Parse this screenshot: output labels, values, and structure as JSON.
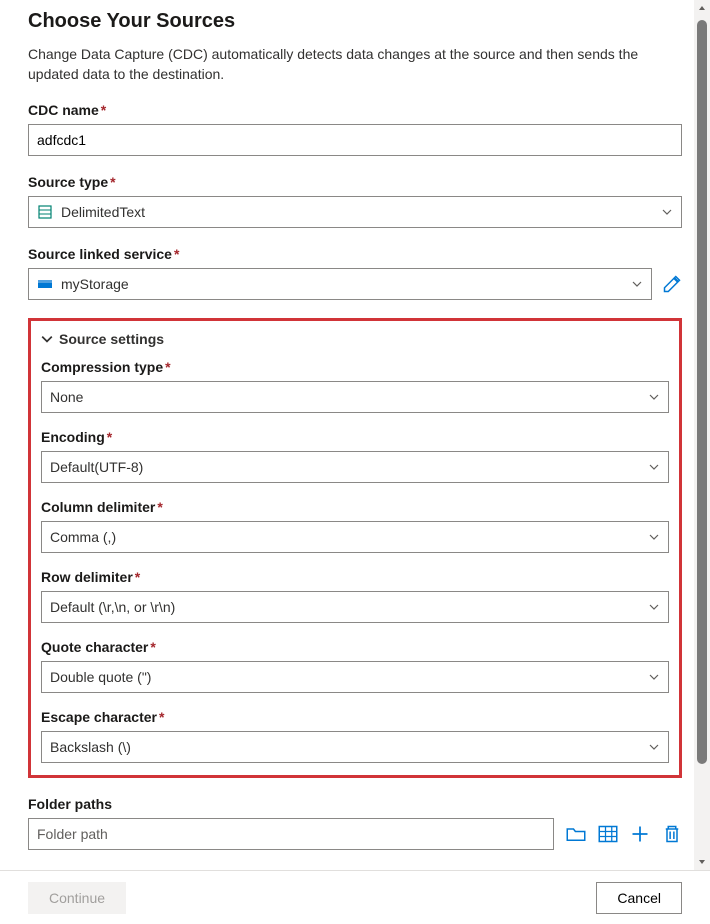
{
  "header": {
    "title": "Choose Your Sources",
    "description": "Change Data Capture (CDC) automatically detects data changes at the source and then sends the updated data to the destination."
  },
  "form": {
    "cdc_name": {
      "label": "CDC name",
      "value": "adfcdc1"
    },
    "source_type": {
      "label": "Source type",
      "value": "DelimitedText"
    },
    "source_linked_service": {
      "label": "Source linked service",
      "value": "myStorage"
    }
  },
  "settings": {
    "header": "Source settings",
    "compression": {
      "label": "Compression type",
      "value": "None"
    },
    "encoding": {
      "label": "Encoding",
      "value": "Default(UTF-8)"
    },
    "column_delimiter": {
      "label": "Column delimiter",
      "value": "Comma (,)"
    },
    "row_delimiter": {
      "label": "Row delimiter",
      "value": "Default (\\r,\\n, or \\r\\n)"
    },
    "quote_char": {
      "label": "Quote character",
      "value": "Double quote (\")"
    },
    "escape_char": {
      "label": "Escape character",
      "value": "Backslash (\\)"
    }
  },
  "folder": {
    "label": "Folder paths",
    "placeholder": "Folder path"
  },
  "footer": {
    "continue": "Continue",
    "cancel": "Cancel"
  }
}
